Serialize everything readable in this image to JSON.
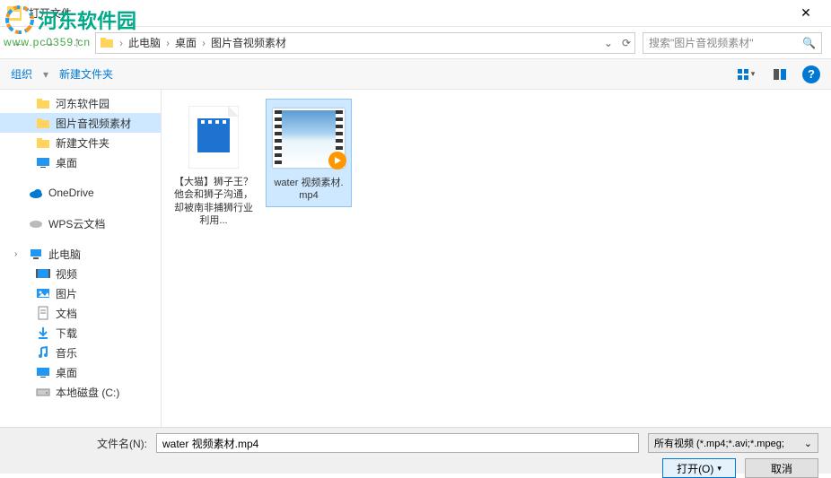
{
  "window": {
    "title": "打开文件"
  },
  "watermark": {
    "text": "河东软件园",
    "url": "www.pc0359.cn"
  },
  "breadcrumb": {
    "items": [
      "此电脑",
      "桌面",
      "图片音视频素材"
    ]
  },
  "search": {
    "placeholder": "搜索\"图片音视频素材\""
  },
  "toolbar": {
    "organize": "组织",
    "newfolder": "新建文件夹"
  },
  "sidebar": {
    "items": [
      {
        "label": "河东软件园",
        "type": "folder",
        "indent": 1
      },
      {
        "label": "图片音视频素材",
        "type": "folder",
        "indent": 1,
        "selected": true
      },
      {
        "label": "新建文件夹",
        "type": "folder",
        "indent": 1
      },
      {
        "label": "桌面",
        "type": "desktop",
        "indent": 1,
        "space_after": true
      },
      {
        "label": "OneDrive",
        "type": "onedrive",
        "indent": 0,
        "space_after": true
      },
      {
        "label": "WPS云文档",
        "type": "wps",
        "indent": 0,
        "space_after": true
      },
      {
        "label": "此电脑",
        "type": "pc",
        "indent": 0
      },
      {
        "label": "视频",
        "type": "video",
        "indent": 1
      },
      {
        "label": "图片",
        "type": "pictures",
        "indent": 1
      },
      {
        "label": "文档",
        "type": "docs",
        "indent": 1
      },
      {
        "label": "下载",
        "type": "downloads",
        "indent": 1
      },
      {
        "label": "音乐",
        "type": "music",
        "indent": 1
      },
      {
        "label": "桌面",
        "type": "desktop",
        "indent": 1
      },
      {
        "label": "本地磁盘 (C:)",
        "type": "drive",
        "indent": 1
      }
    ]
  },
  "files": [
    {
      "name": "【大猫】狮子王？他会和狮子沟通，却被南非捕狮行业利用...",
      "type": "video-doc"
    },
    {
      "name": "water 视频素材.mp4",
      "type": "video-clip",
      "selected": true
    }
  ],
  "footer": {
    "filename_label": "文件名(N):",
    "filename_value": "water 视频素材.mp4",
    "filetype": "所有视频 (*.mp4;*.avi;*.mpeg;",
    "open": "打开(O)",
    "cancel": "取消"
  }
}
